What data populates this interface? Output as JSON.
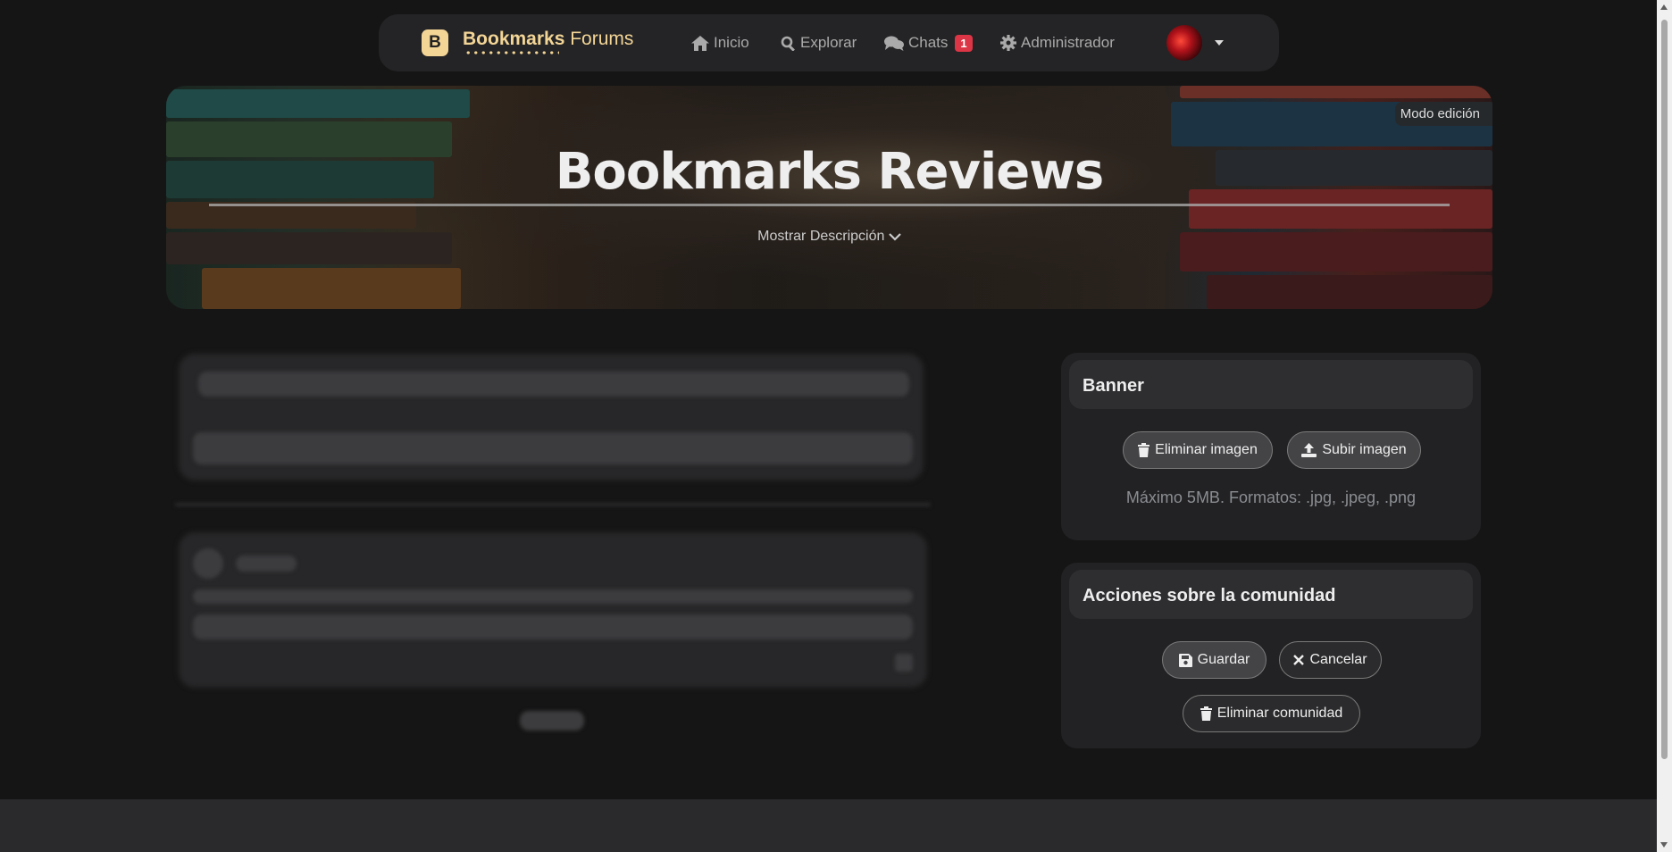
{
  "navbar": {
    "logo_letter": "B",
    "brand_bold": "Bookmarks",
    "brand_rest": "Forums",
    "items": [
      {
        "label": "Inicio",
        "icon": "home-icon"
      },
      {
        "label": "Explorar",
        "icon": "search-icon"
      },
      {
        "label": "Chats",
        "icon": "chat-icon",
        "badge": "1"
      },
      {
        "label": "Administrador",
        "icon": "gear-icon"
      }
    ]
  },
  "banner": {
    "title": "Bookmarks Reviews",
    "show_description": "Mostrar Descripción",
    "edit_mode": "Modo edición"
  },
  "banner_card": {
    "title": "Banner",
    "delete_image": "Eliminar imagen",
    "upload_image": "Subir imagen",
    "hint": "Máximo 5MB. Formatos: .jpg, .jpeg, .png"
  },
  "actions_card": {
    "title": "Acciones sobre la comunidad",
    "save": "Guardar",
    "cancel": "Cancelar",
    "delete_community": "Eliminar comunidad"
  },
  "colors": {
    "brand": "#f3d596",
    "badge": "#dc3545",
    "background": "#151515"
  }
}
